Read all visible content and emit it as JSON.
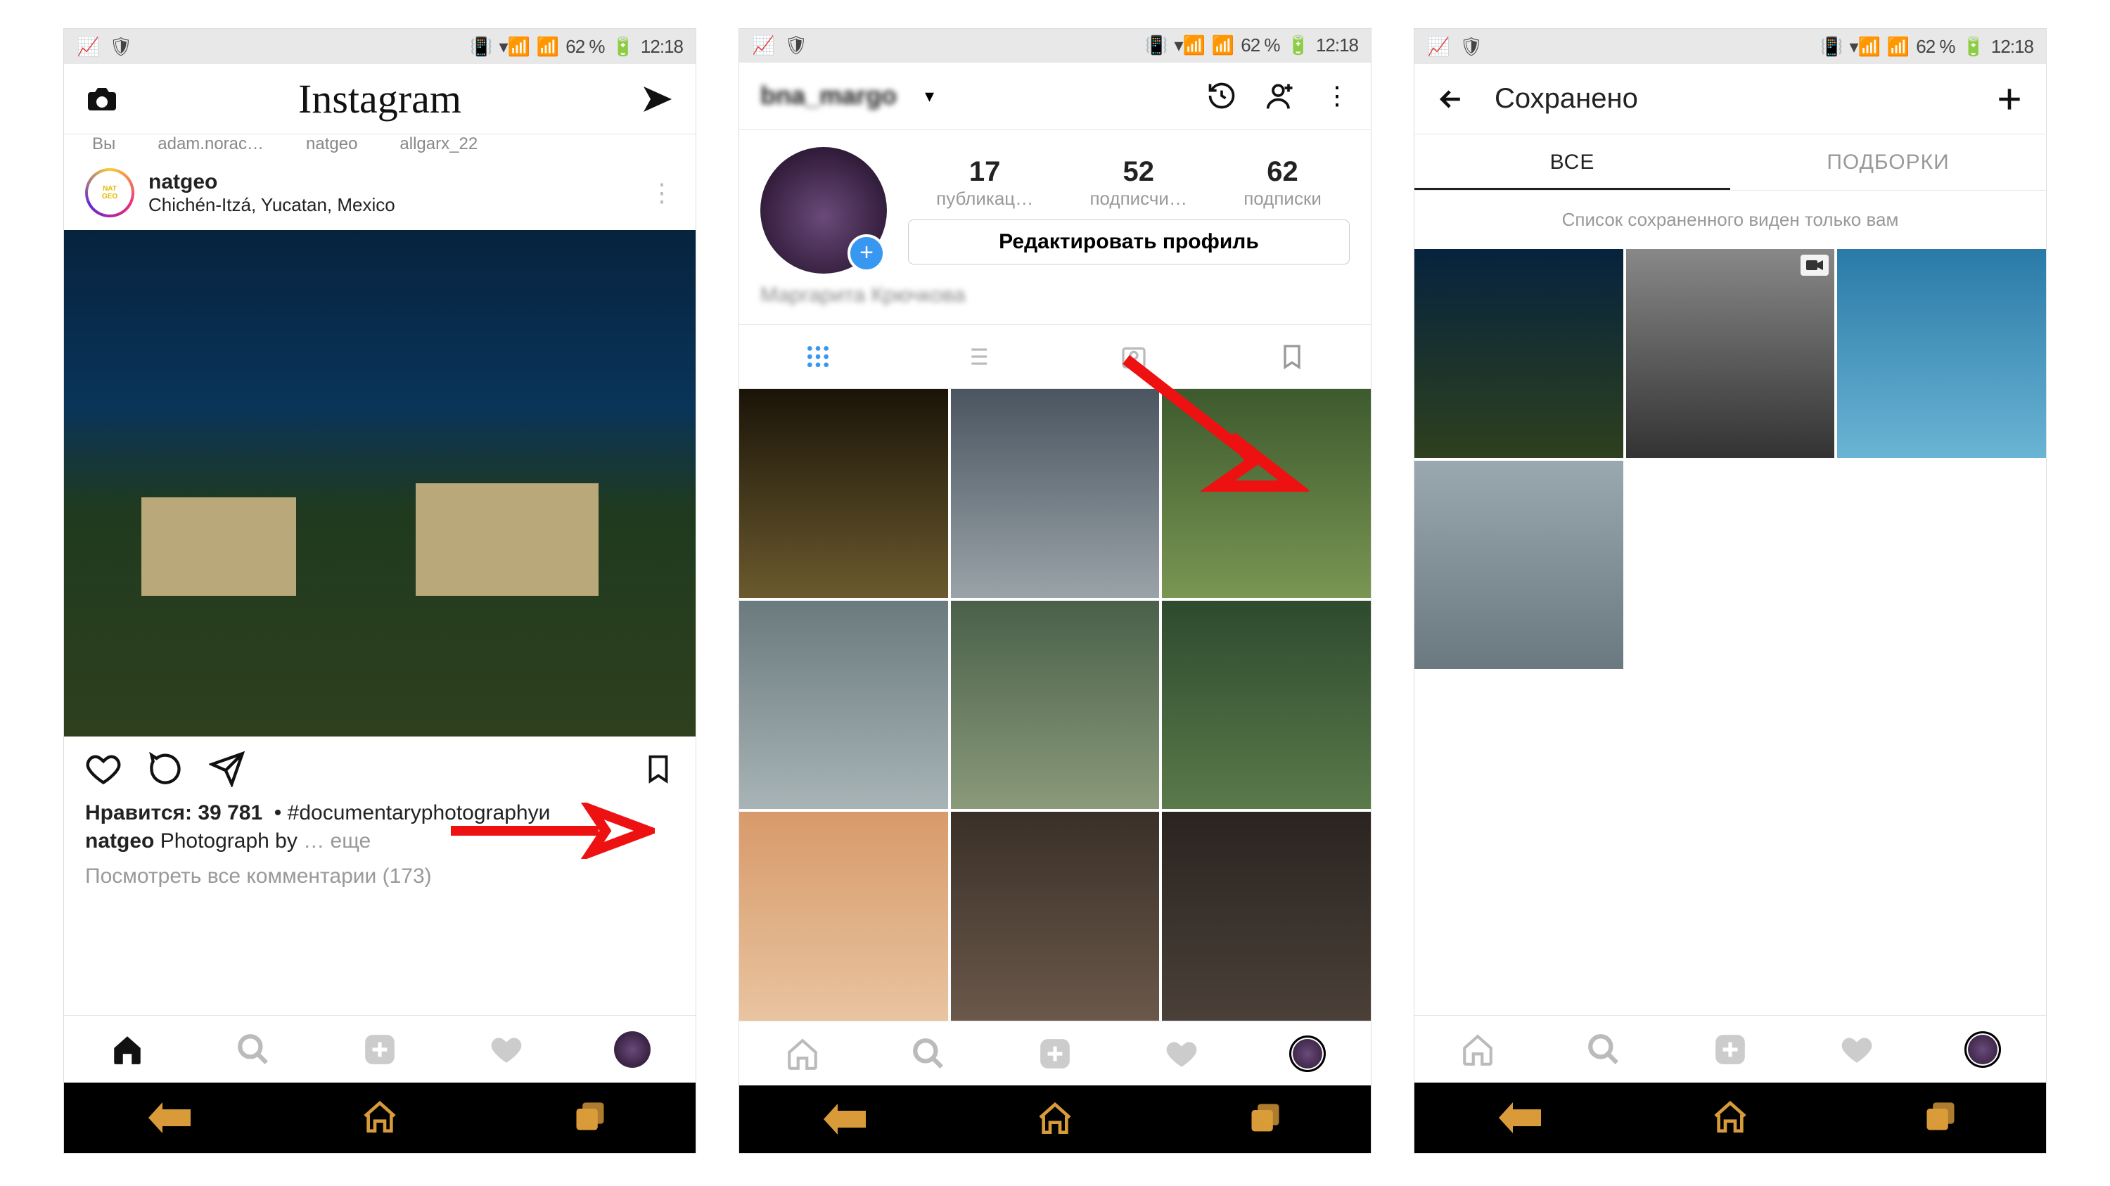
{
  "status": {
    "battery": "62 %",
    "time": "12:18"
  },
  "screen1": {
    "logo": "Instagram",
    "stories": [
      "Вы",
      "adam.norac…",
      "natgeo",
      "allgarx_22"
    ],
    "post": {
      "username": "natgeo",
      "location": "Chichén-Itzá, Yucatan, Mexico",
      "likes_label": "Нравится: 39 781",
      "hashtag": "#documentaryphotographyи",
      "caption_user": "natgeo",
      "caption_text": "Photograph by",
      "more": "… еще",
      "comments_link": "Посмотреть все комментарии (173)"
    }
  },
  "screen2": {
    "username": "bna_margo",
    "stats": {
      "posts_num": "17",
      "posts_label": "публикац…",
      "followers_num": "52",
      "followers_label": "подписчи…",
      "following_num": "62",
      "following_label": "подписки"
    },
    "edit_button": "Редактировать профиль",
    "bio": "Маргарита Крючкова"
  },
  "screen3": {
    "title": "Сохранено",
    "tab_all": "ВСЕ",
    "tab_collections": "ПОДБОРКИ",
    "hint": "Список сохраненного виден только вам"
  },
  "grid_colors_profile": [
    "linear-gradient(#1a1408,#6b5a2e)",
    "linear-gradient(#4a5560,#9aa3a8)",
    "linear-gradient(#3d5a2e,#7a9653)",
    "linear-gradient(#6a7a7d,#a8b4b6)",
    "linear-gradient(#4a604a,#8a9a7a)",
    "linear-gradient(#2e4a2e,#5a7a4a)",
    "linear-gradient(#d89a6a,#e8c4a0)",
    "linear-gradient(#3a3028,#6a584a)",
    "linear-gradient(#2a2420,#4a4038)"
  ],
  "grid_colors_saved": [
    "linear-gradient(#06233e,#2e401e)",
    "linear-gradient(#888,#333)",
    "linear-gradient(#2a7aa8,#6ab4d4)",
    "linear-gradient(#9aa8b0,#6a7880)"
  ]
}
